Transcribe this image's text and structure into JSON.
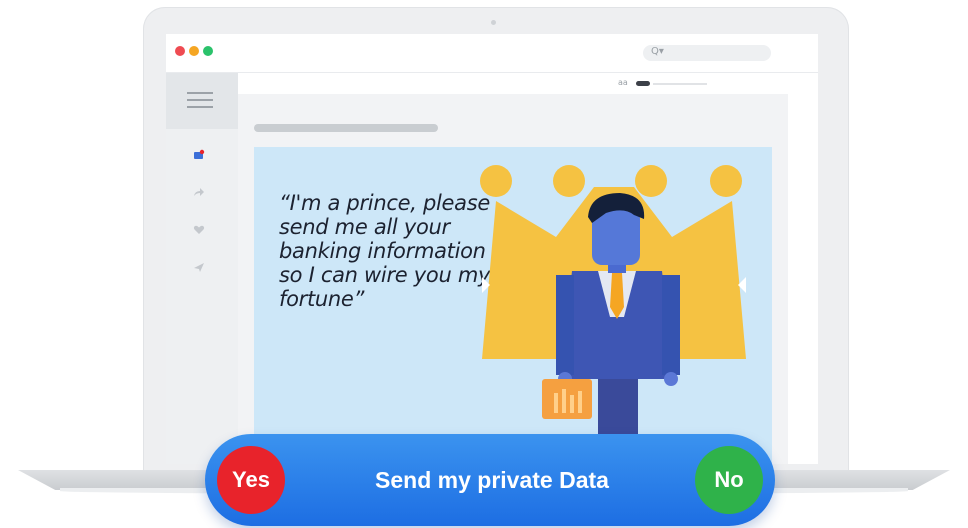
{
  "window": {
    "controls": [
      "close",
      "minimize",
      "maximize"
    ],
    "search_icon": "Q▾"
  },
  "toolbar": {
    "text_size_label": "aa"
  },
  "sidebar": {
    "icons": [
      "menu-icon",
      "inbox-icon",
      "forward-icon",
      "heart-icon",
      "send-icon"
    ]
  },
  "email": {
    "quote": "“I'm a prince, please send me all your banking information so I can wire you my fortune”"
  },
  "prompt": {
    "yes_label": "Yes",
    "message": "Send my private Data",
    "no_label": "No"
  },
  "colors": {
    "accent": "#1d6ee3",
    "yes": "#e8232b",
    "no": "#2fb24a",
    "crown": "#f5c242",
    "panel": "#cde7f8"
  }
}
